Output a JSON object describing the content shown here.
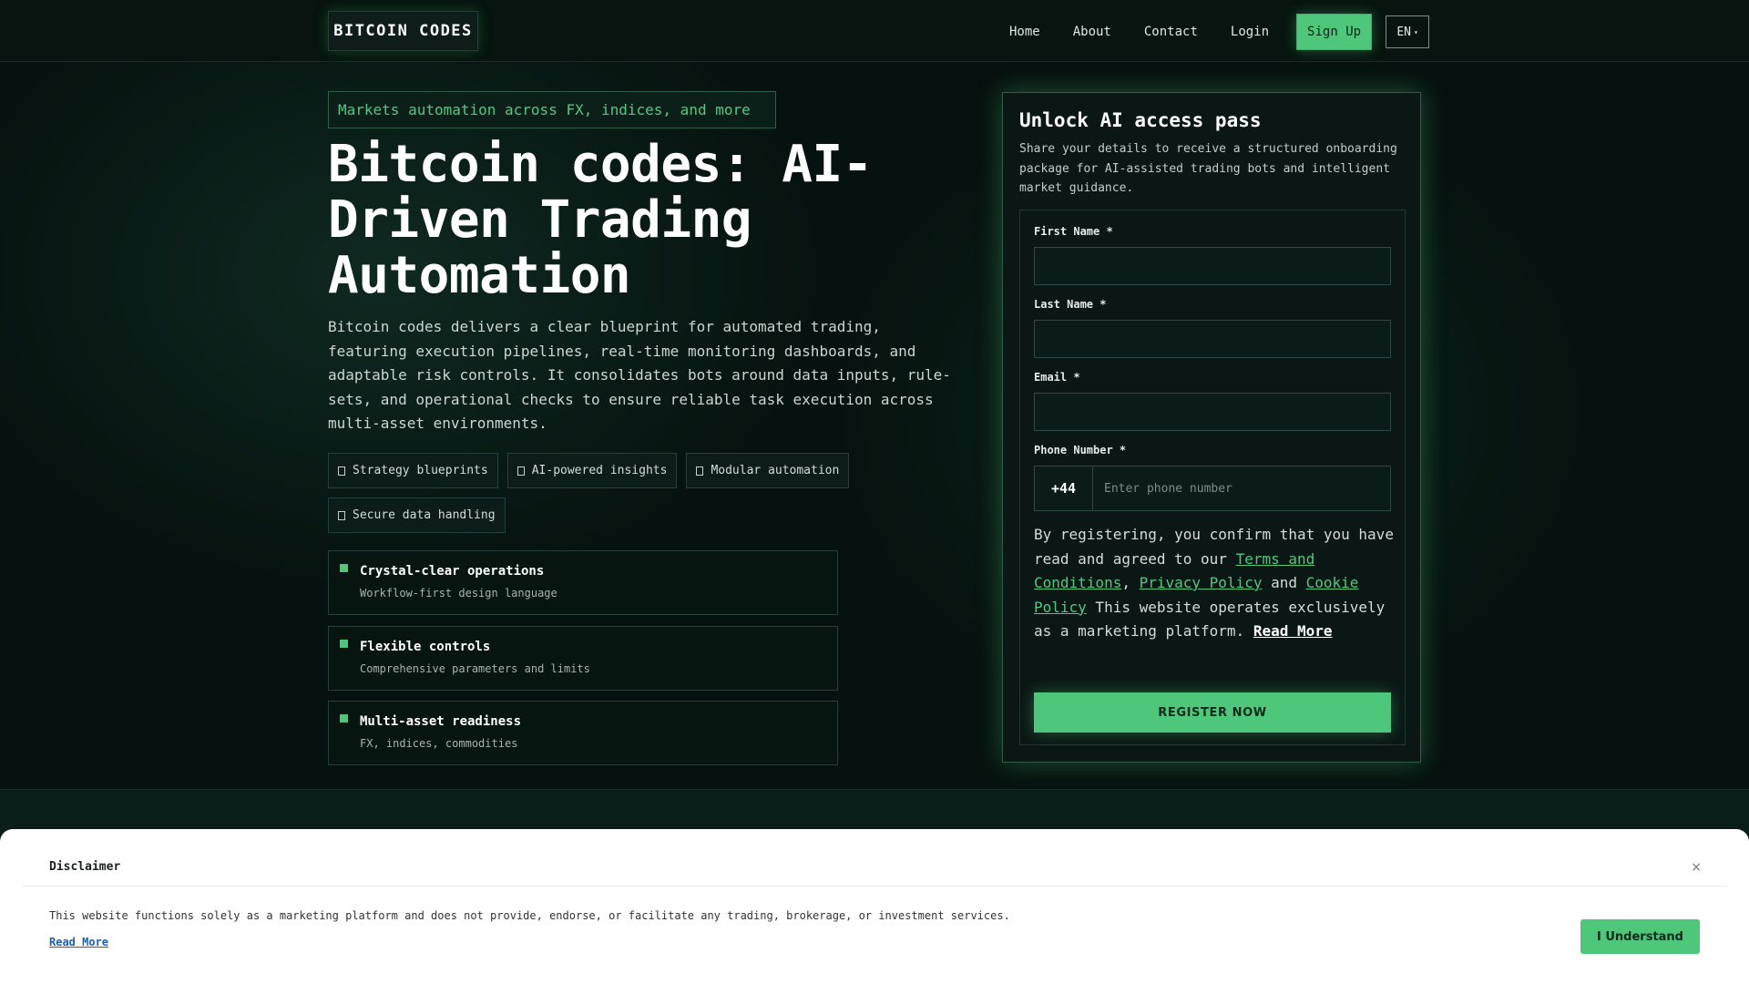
{
  "nav": {
    "logo": "BITCOIN CODES",
    "links": [
      "Home",
      "About",
      "Contact",
      "Login"
    ],
    "signup": "Sign Up",
    "lang": "EN"
  },
  "hero": {
    "tag": "Markets automation across FX, indices, and more",
    "title": "Bitcoin codes: AI-Driven Trading Automation",
    "description": "Bitcoin codes delivers a clear blueprint for automated trading, featuring execution pipelines, real-time monitoring dashboards, and adaptable risk controls. It consolidates bots around data inputs, rule-sets, and operational checks to ensure reliable task execution across multi-asset environments.",
    "chips": [
      "Strategy blueprints",
      "AI-powered insights",
      "Modular automation",
      "Secure data handling"
    ],
    "features": [
      {
        "title": "Crystal-clear operations",
        "subtitle": "Workflow-first design language"
      },
      {
        "title": "Flexible controls",
        "subtitle": "Comprehensive parameters and limits"
      },
      {
        "title": "Multi-asset readiness",
        "subtitle": "FX, indices, commodities"
      }
    ]
  },
  "form": {
    "title": "Unlock AI access pass",
    "subtitle": "Share your details to receive a structured onboarding package for AI-assisted trading bots and intelligent market guidance.",
    "first_name_label": "First Name *",
    "last_name_label": "Last Name *",
    "email_label": "Email *",
    "phone_label": "Phone Number *",
    "phone_prefix": "+44",
    "phone_placeholder": "Enter phone number",
    "consent_1": "By registering, you confirm that you have read and agreed to our ",
    "terms": "Terms and Conditions",
    "comma": ", ",
    "privacy": "Privacy Policy",
    "and": " and ",
    "cookie": "Cookie Policy",
    "consent_2": " This website operates exclusively as a marketing platform. ",
    "read_more": "Read More",
    "register": "REGISTER NOW"
  },
  "disclaimer": {
    "title": "Disclaimer",
    "close": "×",
    "text": "This website functions solely as a marketing platform and does not provide, endorse, or facilitate any trading, brokerage, or investment services.",
    "read_more": "Read More",
    "button": "I Understand"
  }
}
